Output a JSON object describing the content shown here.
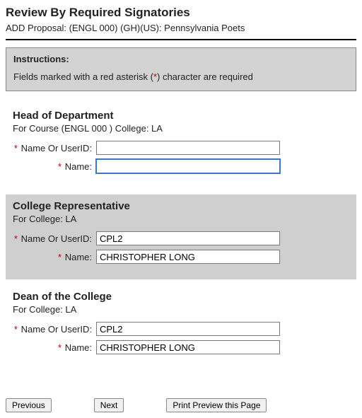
{
  "header": {
    "title": "Review By Required Signatories",
    "subtitle": "ADD Proposal: (ENGL 000) (GH)(US): Pennsylvania Poets"
  },
  "instructions": {
    "title": "Instructions:",
    "text_before": "Fields marked with a red asterisk (",
    "asterisk": "*",
    "text_after": ") character are required"
  },
  "labels": {
    "name_or_userid": "Name Or UserID:",
    "name": "Name:",
    "asterisk": "*"
  },
  "sections": [
    {
      "title": "Head of Department",
      "detail": "For Course (ENGL 000 ) College: LA",
      "shaded": false,
      "name_or_userid": "",
      "name": "",
      "name_focused": true
    },
    {
      "title": "College Representative",
      "detail": "For College: LA",
      "shaded": true,
      "name_or_userid": "CPL2",
      "name": "CHRISTOPHER LONG",
      "name_focused": false
    },
    {
      "title": "Dean of the College",
      "detail": "For College: LA",
      "shaded": false,
      "name_or_userid": "CPL2",
      "name": "CHRISTOPHER LONG",
      "name_focused": false
    }
  ],
  "buttons": {
    "previous": "Previous",
    "next": "Next",
    "print": "Print Preview this Page"
  }
}
